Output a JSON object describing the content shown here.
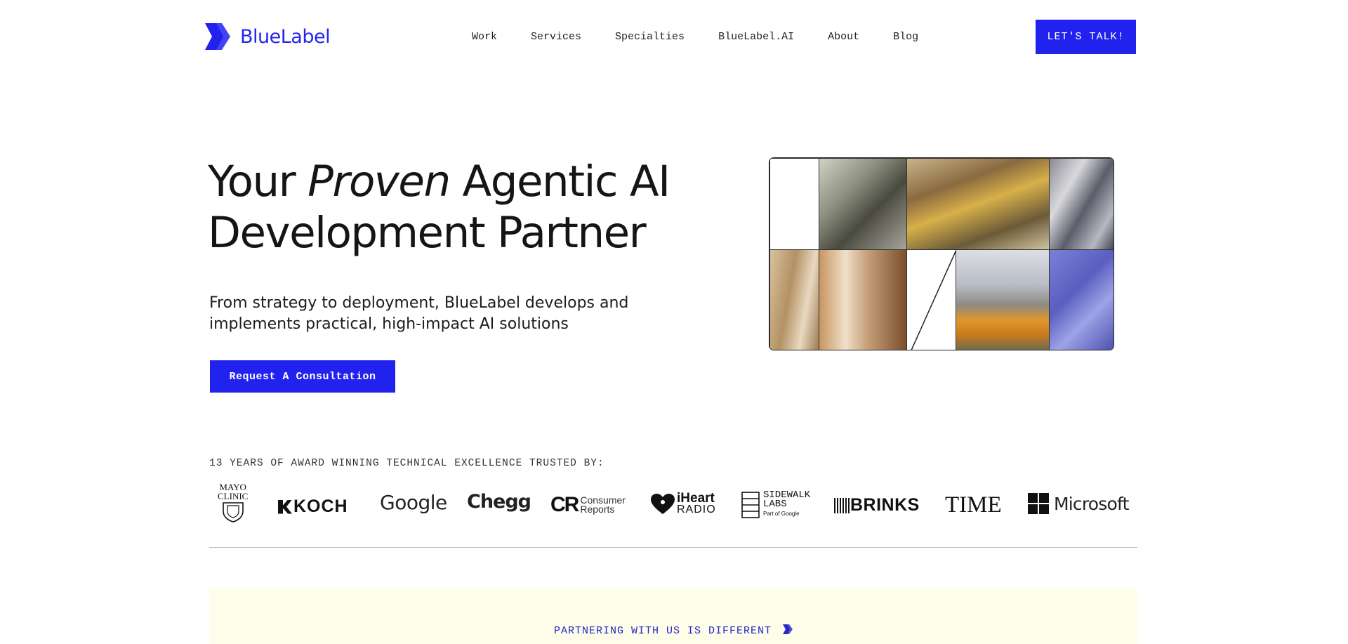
{
  "brand": {
    "name": "BlueLabel",
    "accent": "#2222ee",
    "panel_bg": "#fdfde9"
  },
  "nav": {
    "items": [
      "Work",
      "Services",
      "Specialties",
      "BlueLabel.AI",
      "About",
      "Blog"
    ],
    "cta_label": "LET'S TALK!"
  },
  "hero": {
    "title_before": "Your ",
    "title_emphasis": "Proven",
    "title_after_line1": " Agentic AI",
    "title_line2": "Development Partner",
    "subtitle": "From strategy to deployment, BlueLabel develops and implements practical, high-impact AI solutions",
    "cta_label": "Request A Consultation"
  },
  "trusted": {
    "label": "13 YEARS OF AWARD WINNING TECHNICAL EXCELLENCE TRUSTED BY:",
    "logos": {
      "mayo_line1": "MAYO",
      "mayo_line2": "CLINIC",
      "koch": "KOCH",
      "google": "Google",
      "chegg": "Chegg",
      "cr_mark": "CR",
      "cr_line1": "Consumer",
      "cr_line2": "Reports",
      "iheart_line1": "iHeart",
      "iheart_line2": "RADIO",
      "sidewalk_line1": "SIDEWALK",
      "sidewalk_line2": "LABS",
      "sidewalk_line3": "Part of Google",
      "brinks": "BRINKS",
      "time": "TIME",
      "microsoft": "Microsoft"
    }
  },
  "section": {
    "label": "PARTNERING WITH US IS DIFFERENT"
  }
}
